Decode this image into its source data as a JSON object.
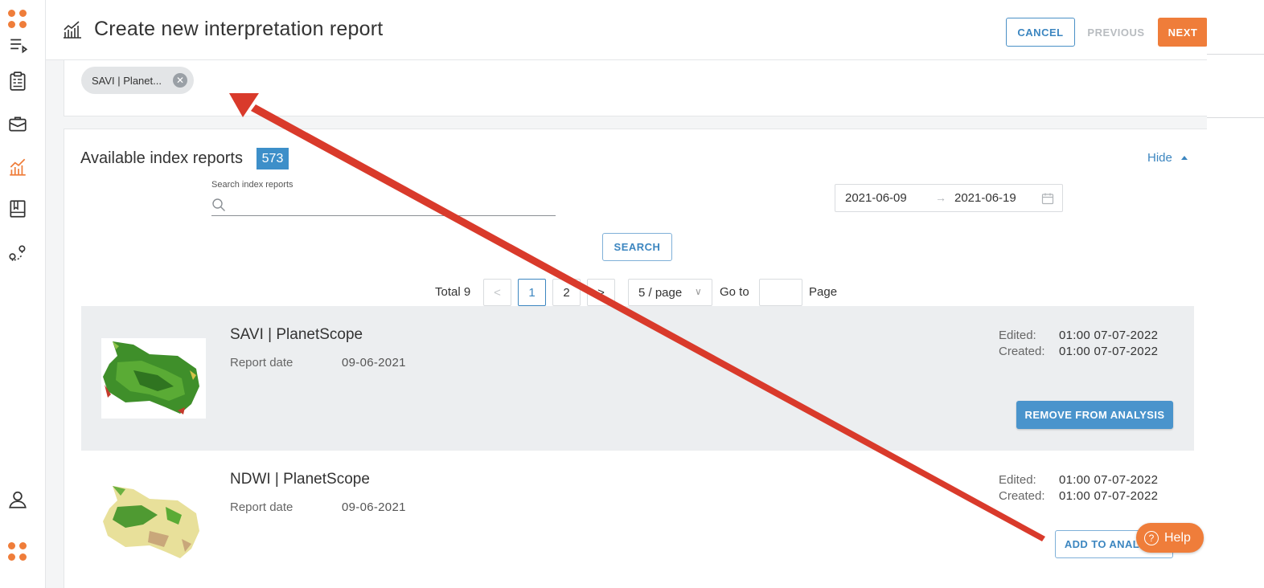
{
  "sidebar": {
    "items": [
      {
        "icon": "app-grid-icon"
      },
      {
        "icon": "menu-expand-icon"
      },
      {
        "icon": "clipboard-icon"
      },
      {
        "icon": "briefcase-icon"
      },
      {
        "icon": "chart-icon"
      },
      {
        "icon": "notebook-icon"
      },
      {
        "icon": "map-pins-icon"
      },
      {
        "icon": "user-icon"
      },
      {
        "icon": "app-grid-icon"
      }
    ],
    "accent_color": "#ef7d3a"
  },
  "header": {
    "title": "Create new interpretation report",
    "cancel_label": "CANCEL",
    "previous_label": "PREVIOUS",
    "next_label": "NEXT"
  },
  "selected_chips": [
    {
      "label": "SAVI | Planet..."
    }
  ],
  "available": {
    "title": "Available index reports",
    "count": "573",
    "hide_label": "Hide"
  },
  "search": {
    "label": "Search index reports",
    "value": "",
    "button_label": "SEARCH"
  },
  "date_range": {
    "from": "2021-06-09",
    "to": "2021-06-19",
    "arrow": "→"
  },
  "pagination": {
    "total_label": "Total 9",
    "prev": "<",
    "next": ">",
    "pages": [
      "1",
      "2"
    ],
    "current": "1",
    "page_size": "5 / page",
    "goto_label": "Go to",
    "goto_value": "",
    "page_label": "Page"
  },
  "reports": [
    {
      "title": "SAVI | PlanetScope",
      "date_label": "Report date",
      "date": "09-06-2021",
      "edited_label": "Edited:",
      "edited": "01:00 07-07-2022",
      "created_label": "Created:",
      "created": "01:00 07-07-2022",
      "action_label": "REMOVE FROM ANALYSIS",
      "selected": true
    },
    {
      "title": "NDWI | PlanetScope",
      "date_label": "Report date",
      "date": "09-06-2021",
      "edited_label": "Edited:",
      "edited": "01:00 07-07-2022",
      "created_label": "Created:",
      "created": "01:00 07-07-2022",
      "action_label": "ADD TO ANALYSIS",
      "selected": false
    }
  ],
  "help": {
    "label": "Help",
    "icon": "question-icon"
  },
  "colors": {
    "accent_orange": "#ef7d3a",
    "primary_blue": "#3c86c0",
    "annotation_red": "#d93a2b"
  }
}
